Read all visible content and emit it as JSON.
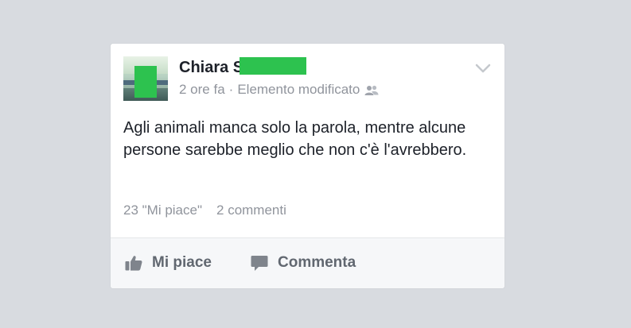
{
  "post": {
    "author_name": "Chiara S",
    "time": "2 ore fa",
    "separator": "·",
    "edited_label": "Elemento modificato",
    "audience_icon": "friends-icon",
    "menu_icon": "chevron-down-icon",
    "text": "Agli animali manca solo la parola, mentre alcune persone sarebbe meglio che non c'è l'avrebbero.",
    "likes_count": "23 \"Mi piace\"",
    "comments_count": "2 commenti"
  },
  "actions": {
    "like_label": "Mi piace",
    "like_icon": "thumbs-up-icon",
    "comment_label": "Commenta",
    "comment_icon": "speech-bubble-icon"
  },
  "colors": {
    "page_background": "#d8dbe0",
    "card_background": "#ffffff",
    "redaction": "#2dc24f",
    "primary_text": "#1d2129",
    "secondary_text": "#90949c",
    "action_text": "#616770"
  }
}
